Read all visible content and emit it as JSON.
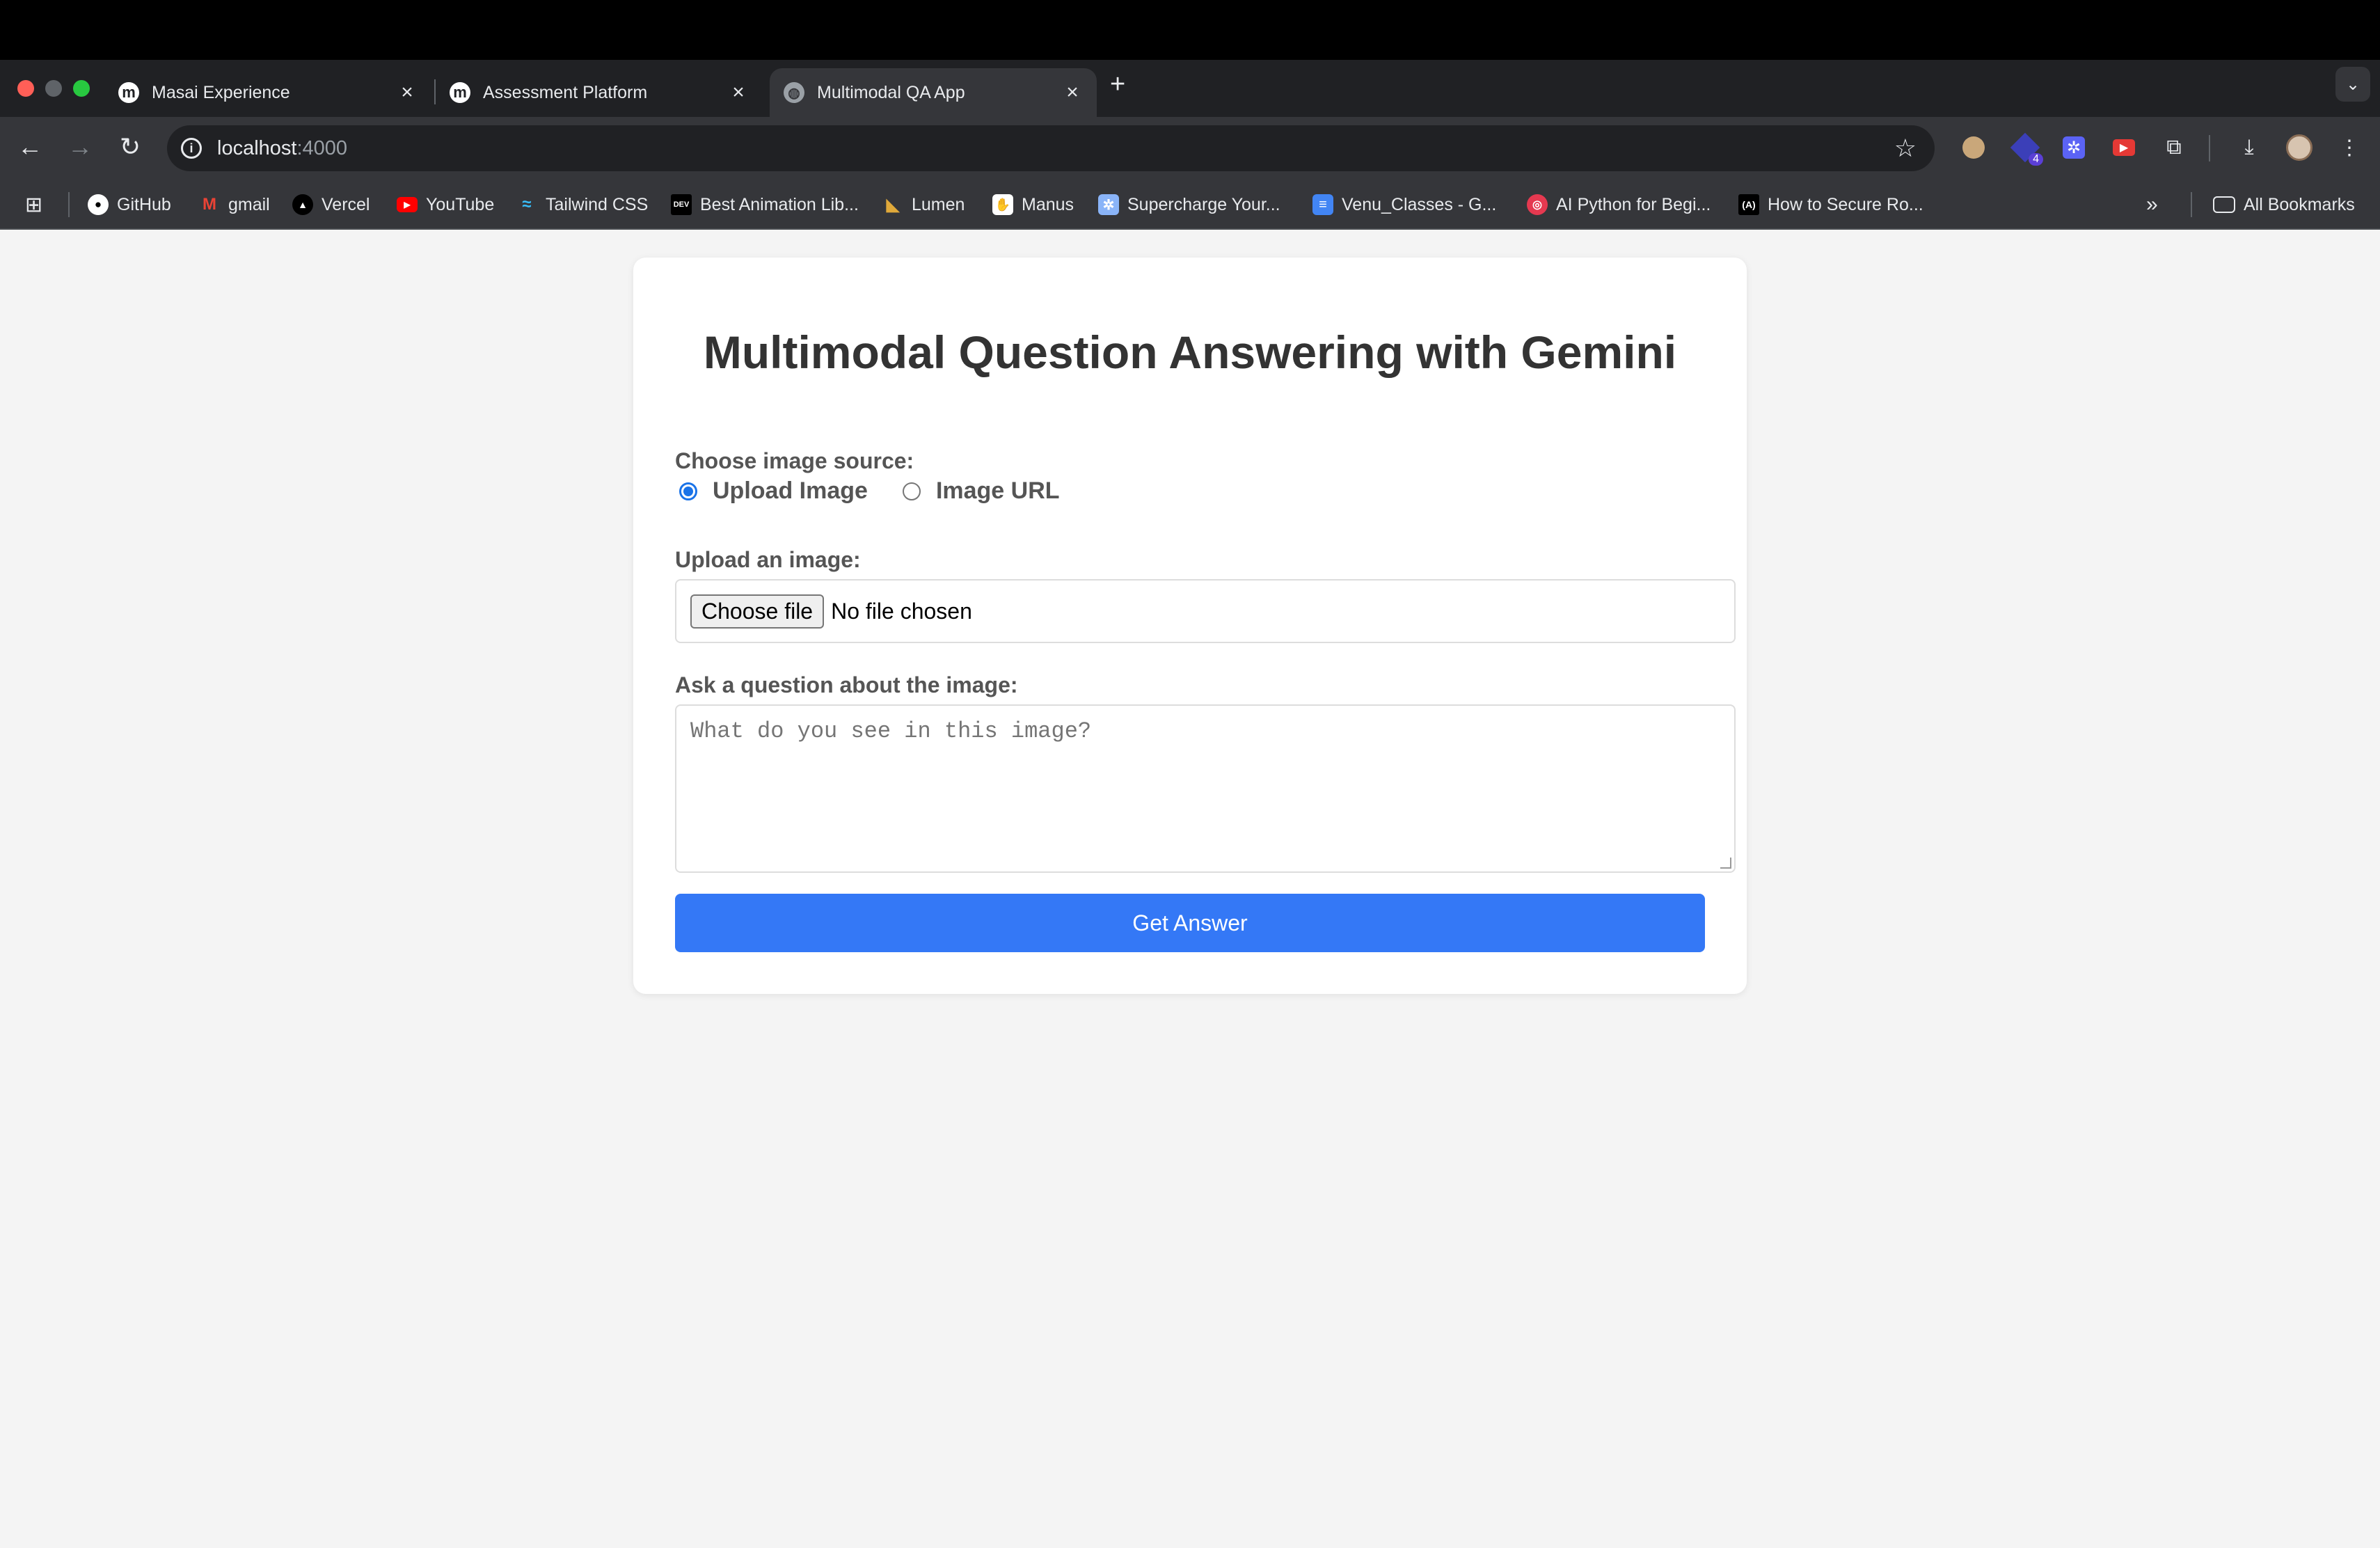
{
  "browser": {
    "tabs": [
      {
        "title": "Masai Experience",
        "favicon": "m"
      },
      {
        "title": "Assessment Platform",
        "favicon": "m"
      },
      {
        "title": "Multimodal QA App",
        "favicon": "globe-icon"
      }
    ],
    "url_host": "localhost",
    "url_port": ":4000",
    "bookmarks": [
      {
        "label": "GitHub",
        "icon": "github-icon"
      },
      {
        "label": "gmail",
        "icon": "gmail-icon"
      },
      {
        "label": "Vercel",
        "icon": "vercel-icon"
      },
      {
        "label": "YouTube",
        "icon": "youtube-icon"
      },
      {
        "label": "Tailwind CSS",
        "icon": "tailwind-icon"
      },
      {
        "label": "Best Animation Lib...",
        "icon": "dev-icon"
      },
      {
        "label": "Lumen",
        "icon": "lumen-icon"
      },
      {
        "label": "Manus",
        "icon": "manus-icon"
      },
      {
        "label": "Supercharge Your...",
        "icon": "gear-icon"
      },
      {
        "label": "Venu_Classes - G...",
        "icon": "docs-icon"
      },
      {
        "label": "AI Python for Begi...",
        "icon": "deeplearning-icon"
      },
      {
        "label": "How to Secure Ro...",
        "icon": "code-icon"
      }
    ],
    "all_bookmarks": "All Bookmarks",
    "extension_badge": "4"
  },
  "page": {
    "title": "Multimodal Question Answering with Gemini",
    "source_label": "Choose image source:",
    "source_options": [
      "Upload Image",
      "Image URL"
    ],
    "selected_source": "Upload Image",
    "upload_label": "Upload an image:",
    "file_button": "Choose file",
    "file_status": "No file chosen",
    "question_label": "Ask a question about the image:",
    "question_placeholder": "What do you see in this image?",
    "submit_label": "Get Answer"
  },
  "colors": {
    "accent": "#3478f6",
    "page_bg": "#f4f4f4",
    "browser_chrome": "#35363a"
  }
}
